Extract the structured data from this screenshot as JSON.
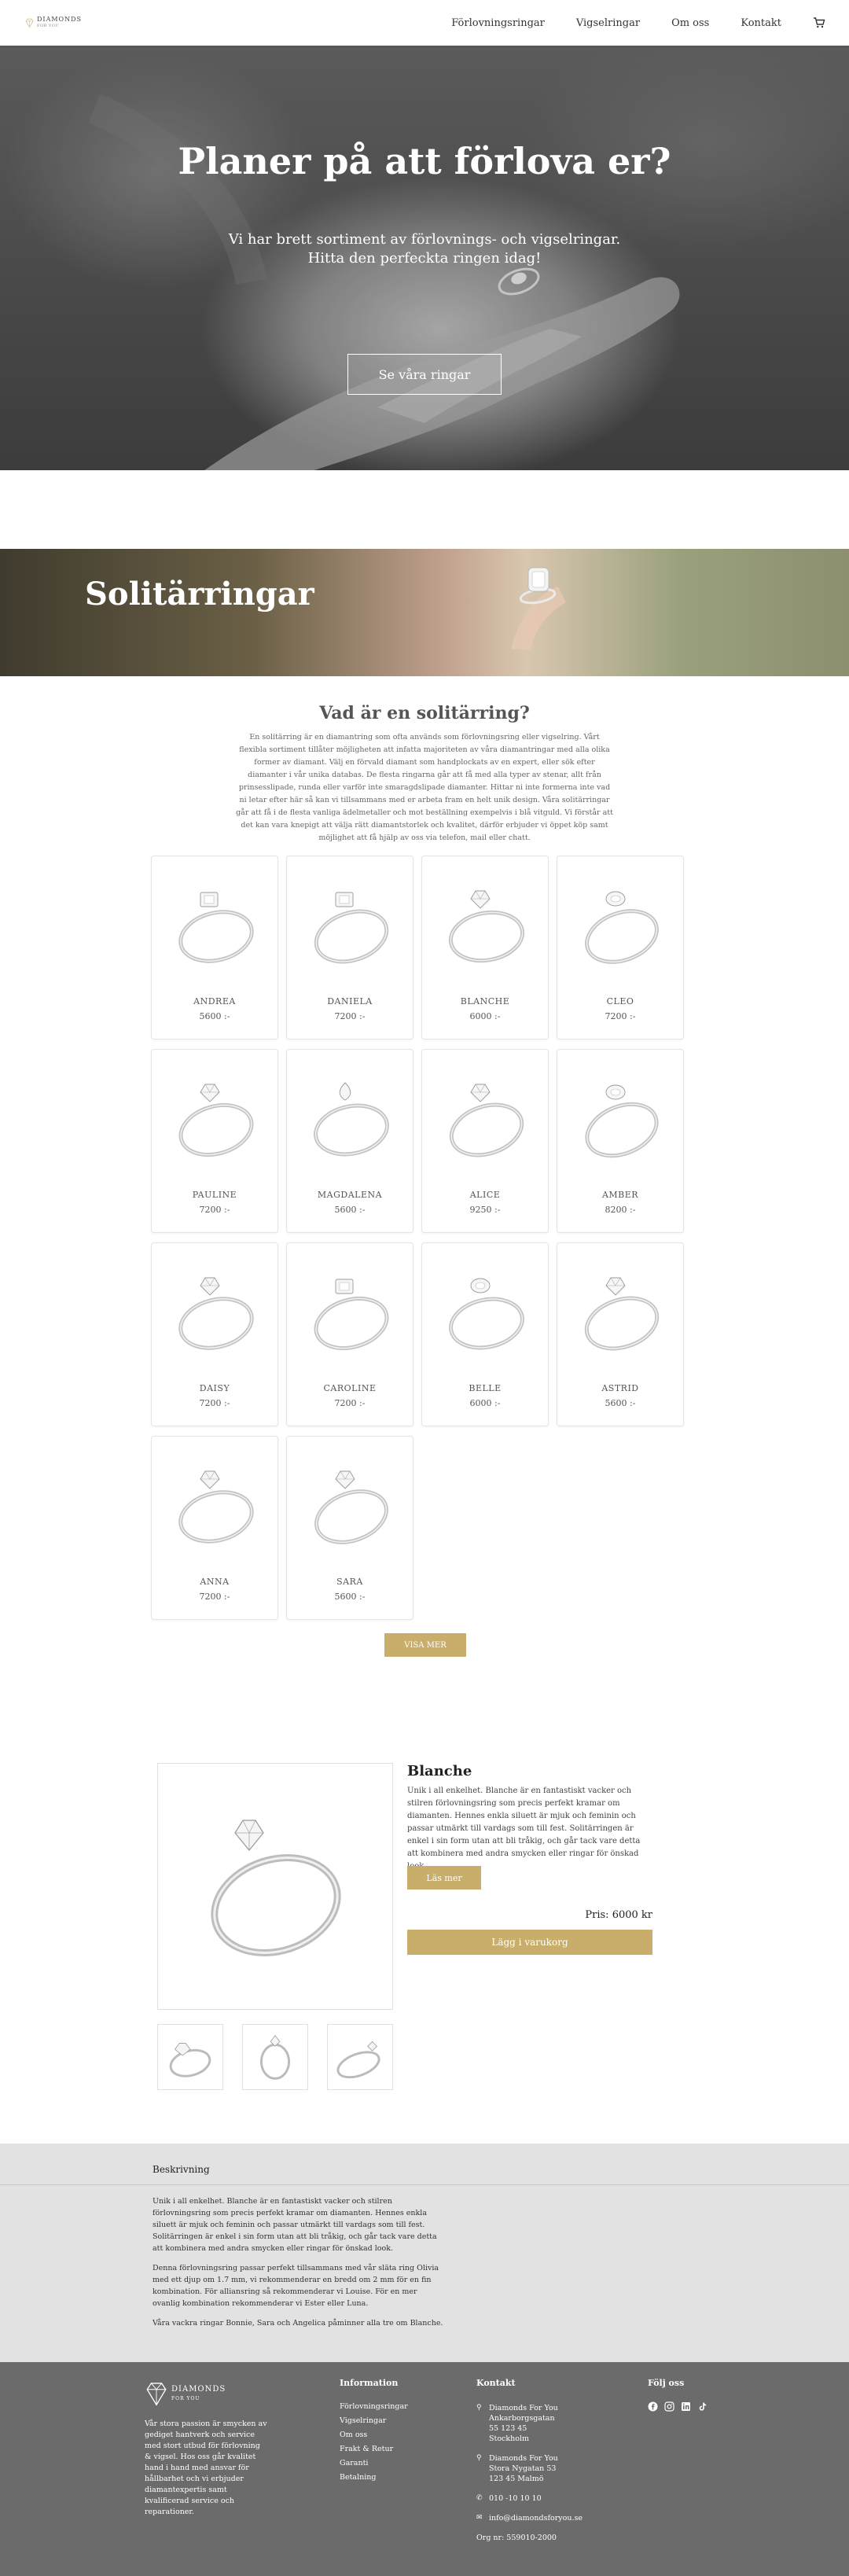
{
  "header": {
    "logo_text": "DIAMONDS",
    "logo_sub": "FOR YOU",
    "nav": [
      "Förlovningsringar",
      "Vigselringar",
      "Om oss",
      "Kontakt"
    ]
  },
  "hero": {
    "title": "Planer på att förlova er?",
    "subtitle": "Vi har brett sortiment av förlovnings- och vigselringar. Hitta den perfeckta ringen idag!",
    "button": "Se våra ringar"
  },
  "banner": {
    "title": "Solitärringar"
  },
  "intro": {
    "title": "Vad är en solitärring?",
    "text": "En solitärring är en diamantring som ofta används som förlovningsring eller vigselring. Vårt flexibla sortiment tillåter möjligheten att infatta majoriteten av våra diamantringar med alla olika former av diamant. Välj en förvald diamant som handplockats av en expert, eller sök efter diamanter i vår unika databas. De flesta ringarna går att få med alla typer av stenar, allt från prinsesslipade, runda eller varför inte smaragdslipade diamanter. Hittar ni inte formerna inte vad ni letar efter här så kan vi tillsammans med er arbeta fram en helt unik design. Våra solitärringar går att få i de flesta vanliga ädelmetaller och mot beställning exempelvis i blå vitguld. Vi förstår att det kan vara knepigt att välja rätt diamantstorlek och kvalitet, därför erbjuder vi öppet köp samt möjlighet att få hjälp av oss via telefon, mail eller chatt."
  },
  "products": [
    {
      "name": "ANDREA",
      "price": "5600 :-"
    },
    {
      "name": "DANIELA",
      "price": "7200 :-"
    },
    {
      "name": "BLANCHE",
      "price": "6000 :-"
    },
    {
      "name": "CLEO",
      "price": "7200 :-"
    },
    {
      "name": "PAULINE",
      "price": "7200 :-"
    },
    {
      "name": "MAGDALENA",
      "price": "5600 :-"
    },
    {
      "name": "ALICE",
      "price": "9250 :-"
    },
    {
      "name": "AMBER",
      "price": "8200 :-"
    },
    {
      "name": "DAISY",
      "price": "7200 :-"
    },
    {
      "name": "CAROLINE",
      "price": "7200 :-"
    },
    {
      "name": "BELLE",
      "price": "6000 :-"
    },
    {
      "name": "ASTRID",
      "price": "5600 :-"
    },
    {
      "name": "ANNA",
      "price": "7200 :-"
    },
    {
      "name": "SARA",
      "price": "5600 :-"
    }
  ],
  "show_more": "VISA MER",
  "product_detail": {
    "name": "Blanche",
    "description": "Unik i all enkelhet. Blanche är en fantastiskt vacker och stilren förlovningsring som precis perfekt kramar om diamanten. Hennes enkla siluett är mjuk och feminin och passar utmärkt till vardags som till fest. Solitärringen är enkel i sin form utan att bli tråkig, och går tack vare detta att kombinera med andra smycken eller ringar för önskad look.",
    "read_more": "Läs mer",
    "price_label": "Pris:",
    "price": "6000 kr",
    "add_to_cart": "Lägg i varukorg"
  },
  "description_tab": {
    "title": "Beskrivning",
    "paragraphs": [
      "Unik i all enkelhet. Blanche är en fantastiskt vacker och stilren förlovningsring som precis perfekt kramar om diamanten. Hennes enkla siluett är mjuk och feminin och passar utmärkt till vardags som till fest. Solitärringen är enkel i sin form utan att bli tråkig, och går tack vare detta att kombinera med andra smycken eller ringar för önskad look.",
      "Denna förlovningsring passar perfekt tillsammans med vår släta ring Olivia med ett djup om 1.7 mm, vi rekommenderar en bredd om 2 mm för en fin kombination. För alliansring så rekommenderar vi Louise. För en mer ovanlig kombination rekommenderar vi Ester eller Luna.",
      "Våra vackra ringar Bonnie, Sara och Angelica påminner alla tre om Blanche."
    ]
  },
  "footer": {
    "about": "Vår stora passion är smycken av gediget hantverk och service med stort utbud för förlovning & vigsel. Hos oss går kvalitet hand i hand med ansvar för hållbarhet och vi erbjuder diamantexpertis samt kvalificerad service och reparationer.",
    "info_title": "Information",
    "info_links": [
      "Förlovningsringar",
      "Vigselringar",
      "Om oss",
      "Frakt & Retur",
      "Garanti",
      "Betalning"
    ],
    "contact_title": "Kontakt",
    "address1": [
      "Diamonds For You",
      "Ankarborgsgatan",
      "55 123 45",
      "Stockholm"
    ],
    "address2": [
      "Diamonds For You",
      "Stora Nygatan 53",
      "123 45 Malmö"
    ],
    "phone": "010 -10 10 10",
    "email": "info@diamondsforyou.se",
    "org": "Org nr: 559010-2000",
    "follow_title": "Följ oss"
  },
  "colors": {
    "accent": "#c8ad6b",
    "footer_bg": "#6b6b6b",
    "desc_bg": "#e2e2e2"
  }
}
